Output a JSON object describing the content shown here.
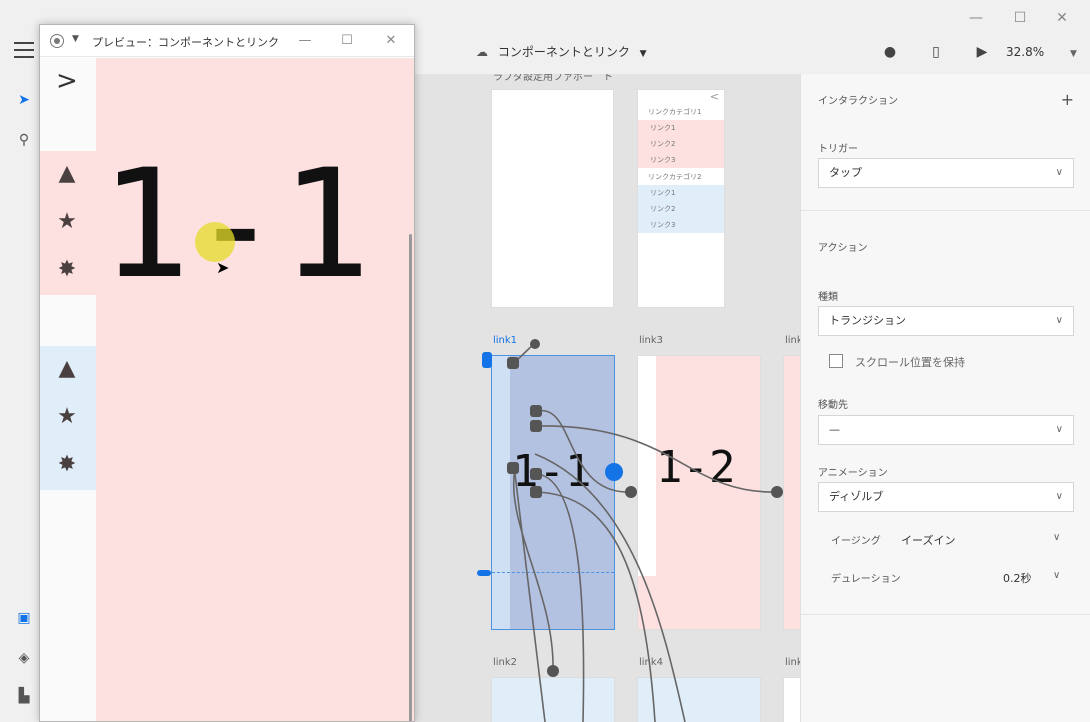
{
  "app": {
    "doc_title": "コンポーネントとリンク",
    "zoom": "32.8%",
    "window_controls": [
      "—",
      "☐",
      "✕"
    ]
  },
  "preview": {
    "title": "プレビュー：コンポーネントとリンク",
    "big_text": "1-1",
    "back_glyph": ">"
  },
  "canvas": {
    "top_board_label": "ラブダ設定用ファボー　ト",
    "menu_board": {
      "back": "<",
      "category1": "リンクカテゴリ1",
      "category2": "リンクカテゴリ2",
      "links": [
        "リンク1",
        "リンク2",
        "リンク3"
      ]
    },
    "artboards": [
      {
        "label": "link1",
        "active": true,
        "text": "1-1"
      },
      {
        "label": "link3",
        "active": false,
        "text": "1-2"
      },
      {
        "label": "link2",
        "active": false,
        "text": ""
      },
      {
        "label": "link4",
        "active": false,
        "text": ""
      },
      {
        "label": "link",
        "active": false,
        "text": ""
      },
      {
        "label": "link",
        "active": false,
        "text": ""
      }
    ]
  },
  "panel": {
    "interaction_heading": "インタラクション",
    "trigger_label": "トリガー",
    "trigger_value": "タップ",
    "action_heading": "アクション",
    "type_label": "種類",
    "type_value": "トランジション",
    "preserve_scroll_label": "スクロール位置を保持",
    "destination_label": "移動先",
    "destination_value": "—",
    "animation_label": "アニメーション",
    "animation_value": "ディゾルブ",
    "easing_label": "イージング",
    "easing_value": "イーズイン",
    "duration_label": "デュレーション",
    "duration_value": "0.2秒"
  }
}
